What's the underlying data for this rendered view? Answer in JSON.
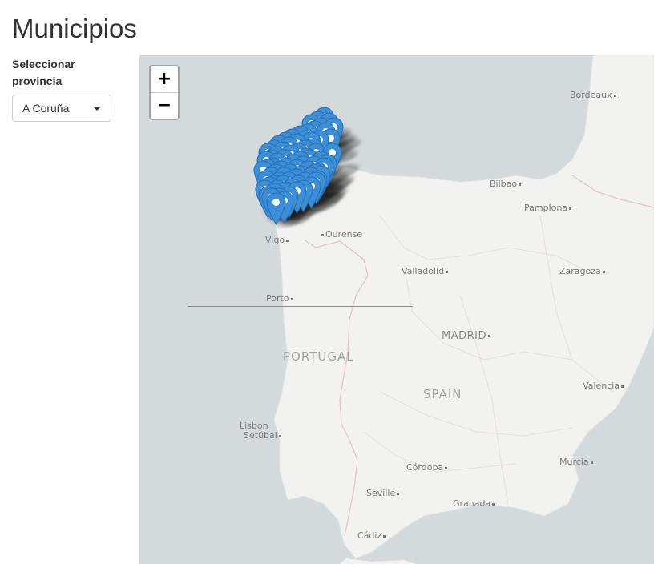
{
  "page_title": "Municipios",
  "sidebar": {
    "select_label": "Seleccionar provincia",
    "select_value": "A Coruña"
  },
  "map": {
    "zoom_in_label": "+",
    "zoom_out_label": "−",
    "marker_color": "#3b8fd8",
    "water_color": "#d4dadc",
    "land_color": "#f2f2f0",
    "cities": {
      "bordeaux": "Bordeaux",
      "bilbao": "Bilbao",
      "pamplona": "Pamplona",
      "vigo": "Vigo",
      "ourense": "Ourense",
      "valladolid": "Valladolid",
      "zaragoza": "Zaragoza",
      "porto": "Porto",
      "madrid": "MADRID",
      "valencia": "Valencia",
      "lisbon": "Lisbon",
      "setubal": "Setúbal",
      "cordoba": "Córdoba",
      "murcia": "Murcia",
      "seville": "Seville",
      "granada": "Granada",
      "cadiz": "Cádiz"
    },
    "countries": {
      "portugal": "PORTUGAL",
      "spain": "SPAIN"
    }
  }
}
